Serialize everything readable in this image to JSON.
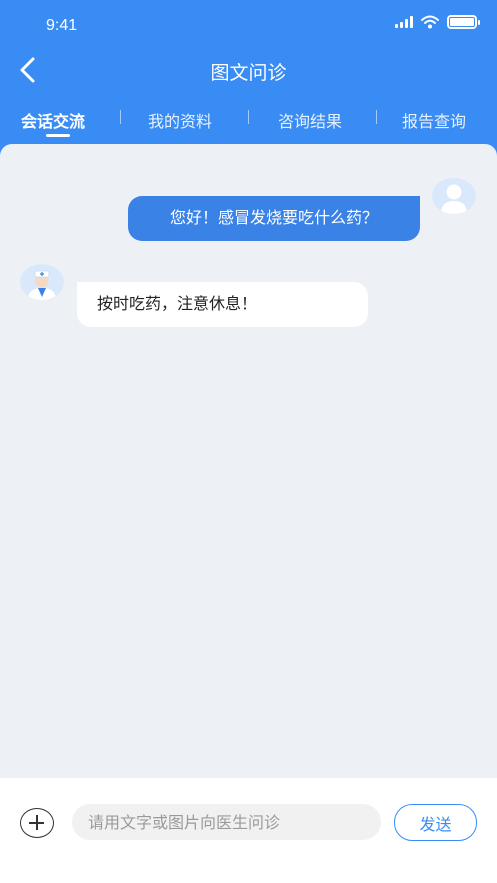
{
  "status_bar": {
    "time": "9:41",
    "icons": [
      "signal-icon",
      "wifi-icon",
      "battery-icon"
    ]
  },
  "header": {
    "title": "图文问诊",
    "back_icon": "chevron-left-icon"
  },
  "tabs": [
    {
      "label": "会话交流",
      "active": true
    },
    {
      "label": "我的资料",
      "active": false
    },
    {
      "label": "咨询结果",
      "active": false
    },
    {
      "label": "报告查询",
      "active": false
    }
  ],
  "messages": [
    {
      "sender": "user",
      "avatar": "user-avatar-icon",
      "text": "您好！感冒发烧要吃什么药？"
    },
    {
      "sender": "doctor",
      "avatar": "doctor-avatar-icon",
      "text": "按时吃药，注意休息！"
    }
  ],
  "composer": {
    "add_icon": "plus-circle-icon",
    "placeholder": "请用文字或图片向医生问诊",
    "value": "",
    "send_label": "发送"
  },
  "colors": {
    "primary": "#3a8cf5",
    "bubble_out": "#3b82e6",
    "chat_bg": "#edf1f6"
  }
}
